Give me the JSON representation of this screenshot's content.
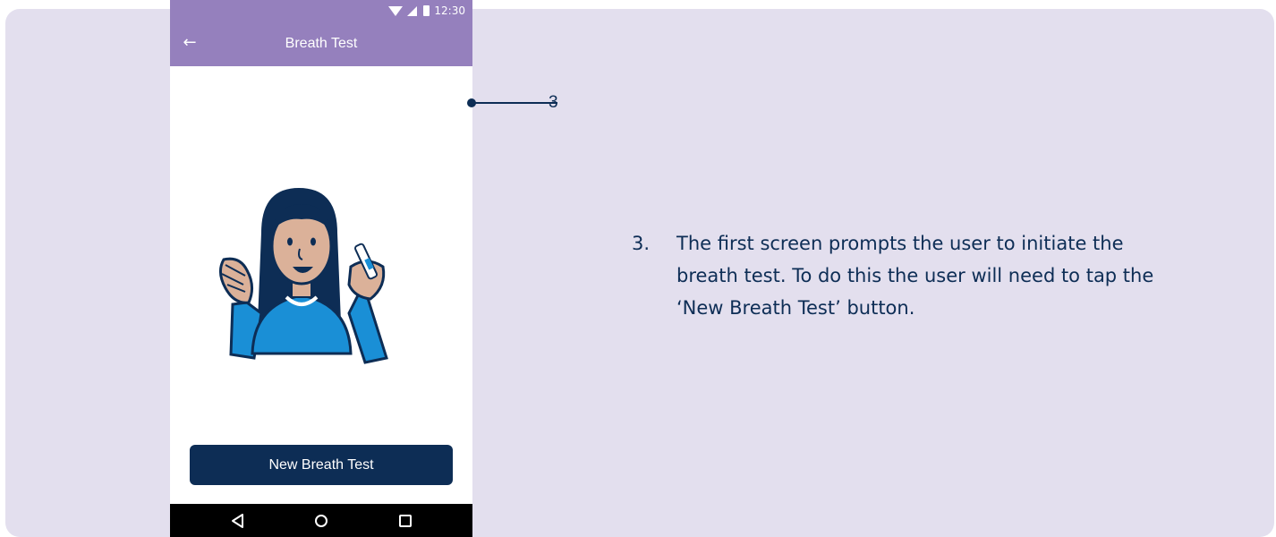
{
  "colors": {
    "panel_background": "#e3dfee",
    "appbar": "#9580bd",
    "primary_dark": "#0d2d55",
    "navbar": "#000000"
  },
  "phone": {
    "status_bar": {
      "time": "12:30",
      "icons": [
        "wifi-icon",
        "signal-icon",
        "battery-icon"
      ]
    },
    "app_bar": {
      "back_icon": "arrow-left-icon",
      "title": "Breath Test"
    },
    "illustration": "woman-holding-breath-test-device",
    "primary_button_label": "New Breath Test",
    "nav_bar": {
      "icons": [
        "nav-back-icon",
        "nav-home-icon",
        "nav-recent-icon"
      ]
    }
  },
  "callout": {
    "number": "3"
  },
  "instruction": {
    "number": "3.",
    "text": "The first screen prompts the user to initiate the breath test. To do this the user will need to tap the ‘New Breath Test’ button."
  }
}
